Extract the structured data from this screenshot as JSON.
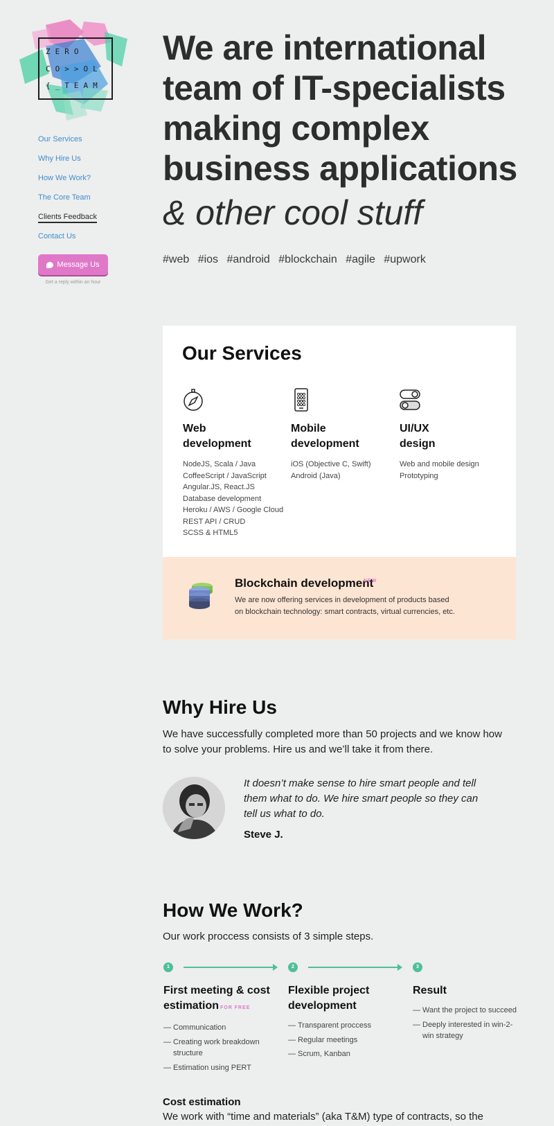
{
  "logo": {
    "line1": "ZERO",
    "line2": "CO>>OL",
    "line3": "{_TEAM"
  },
  "nav": {
    "items": [
      {
        "label": "Our Services"
      },
      {
        "label": "Why Hire Us"
      },
      {
        "label": "How We Work?"
      },
      {
        "label": "The Core Team"
      },
      {
        "label": "Clients Feedback",
        "active": true
      },
      {
        "label": "Contact Us"
      }
    ],
    "message_button": "Message Us",
    "reply_note": "Get a reply within an hour"
  },
  "hero": {
    "title": "We are international team of IT-specialists making complex business applications",
    "subtitle": "& other cool stuff",
    "tags": [
      "#web",
      "#ios",
      "#android",
      "#blockchain",
      "#agile",
      "#upwork"
    ]
  },
  "services": {
    "title": "Our Services",
    "items": [
      {
        "icon": "compass-icon",
        "title_line1": "Web",
        "title_line2": "development",
        "lines": [
          "NodeJS, Scala / Java",
          "CoffeeScript / JavaScript",
          "Angular.JS, React.JS",
          "Database development",
          "Heroku / AWS / Google Cloud",
          "REST API / CRUD",
          "SCSS & HTML5"
        ]
      },
      {
        "icon": "phone-icon",
        "title_line1": "Mobile",
        "title_line2": "development",
        "lines": [
          "iOS (Objective C, Swift)",
          "Android (Java)"
        ]
      },
      {
        "icon": "toggle-icon",
        "title_line1": "UI/UX",
        "title_line2": "design",
        "lines": [
          "Web and mobile design",
          "Prototyping"
        ]
      }
    ],
    "blockchain": {
      "title": "Blockchain development",
      "badge": "NEW",
      "text_line1": "We are now offering services in development of products based",
      "text_line2": "on blockchain technology: smart contracts, virtual currencies, etc."
    }
  },
  "why": {
    "title": "Why Hire Us",
    "text": "We have successfully completed more than 50 projects and we know how to solve your problems. Hire us and we’ll take it from there.",
    "quote": "It doesn’t make sense to hire smart people and tell them what to do. We hire smart people so they can tell us what to do.",
    "quote_author": "Steve J."
  },
  "how": {
    "title": "How We Work?",
    "text": "Our work proccess consists of 3 simple steps.",
    "steps": [
      {
        "num": "1",
        "title_line1": "First meeting & cost",
        "title_line2": "estimation",
        "badge": "FOR FREE",
        "items": [
          "Communication",
          "Creating work breakdown structure",
          "Estimation using PERT"
        ]
      },
      {
        "num": "2",
        "title_line1": "Flexible project",
        "title_line2": "development",
        "items": [
          "Transparent proccess",
          "Regular meetings",
          "Scrum, Kanban"
        ]
      },
      {
        "num": "3",
        "title_line1": "Result",
        "title_line2": "",
        "items": [
          "Want the project to succeed",
          "Deeply interested in win-2-win strategy"
        ]
      }
    ]
  },
  "cost": {
    "title": "Cost estimation",
    "text": "We work with “time and materials” (aka T&M) type of contracts, so the"
  },
  "colors": {
    "accent_blue": "#3f8dcb",
    "accent_pink": "#e078c8",
    "accent_green": "#4fbf9a",
    "blockchain_bg": "#fde5d3"
  }
}
